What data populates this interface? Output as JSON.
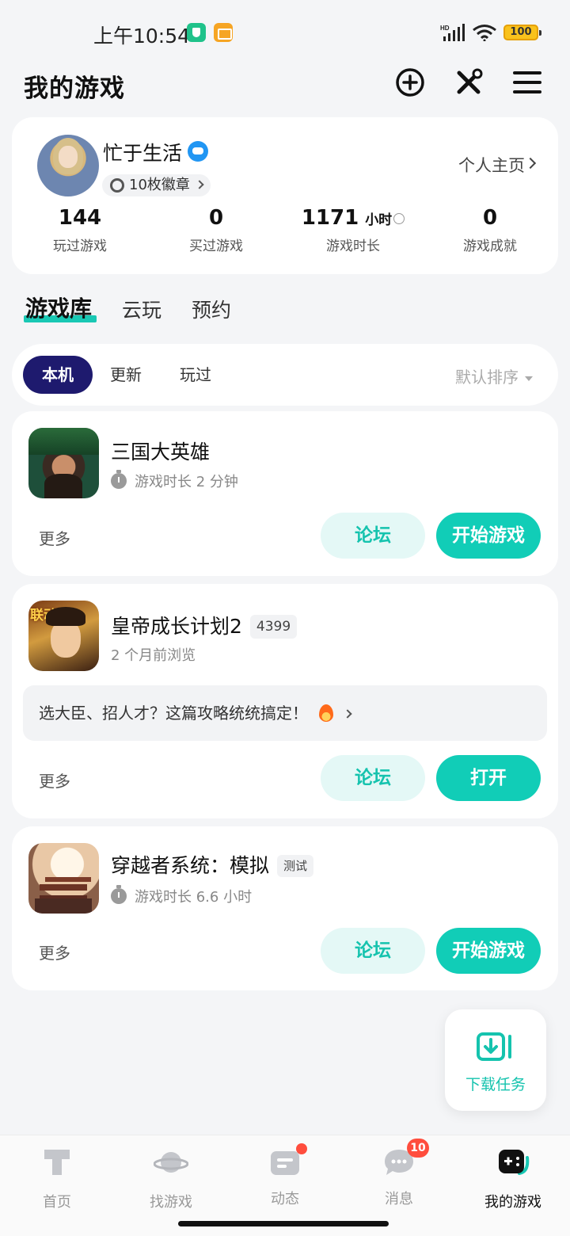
{
  "status_bar": {
    "time": "上午10:54",
    "battery": "100"
  },
  "header": {
    "title": "我的游戏",
    "icons": [
      "add-circle-icon",
      "tools-icon",
      "menu-icon"
    ]
  },
  "profile": {
    "name": "忙于生活",
    "badges": "10枚徽章",
    "home_link": "个人主页",
    "stats": [
      {
        "value": "144",
        "unit": "",
        "label": "玩过游戏"
      },
      {
        "value": "0",
        "unit": "",
        "label": "买过游戏"
      },
      {
        "value": "1171",
        "unit": "小时",
        "label": "游戏时长"
      },
      {
        "value": "0",
        "unit": "",
        "label": "游戏成就"
      }
    ]
  },
  "main_tabs": [
    "游戏库",
    "云玩",
    "预约"
  ],
  "filters": {
    "chips": [
      "本机",
      "更新",
      "玩过"
    ],
    "sort": "默认排序"
  },
  "games": [
    {
      "title": "三国大英雄",
      "tag": "",
      "meta": "游戏时长 2 分钟",
      "more": "更多",
      "forum": "论坛",
      "action": "开始游戏"
    },
    {
      "title": "皇帝成长计划2",
      "tag": "4399",
      "icon_text": "联动",
      "meta": "2 个月前浏览",
      "guide": "选大臣、招人才？这篇攻略统统搞定！",
      "more": "更多",
      "forum": "论坛",
      "action": "打开"
    },
    {
      "title": "穿越者系统：模拟",
      "tag": "测试",
      "meta": "游戏时长 6.6 小时",
      "more": "更多",
      "forum": "论坛",
      "action": "开始游戏"
    }
  ],
  "download_task": "下载任务",
  "bottom_nav": [
    {
      "label": "首页",
      "badge": ""
    },
    {
      "label": "找游戏",
      "badge": ""
    },
    {
      "label": "动态",
      "badge": "dot"
    },
    {
      "label": "消息",
      "badge": "10"
    },
    {
      "label": "我的游戏",
      "badge": ""
    }
  ],
  "colors": {
    "accent": "#11cdb7",
    "chip_active": "#1e1a6e",
    "badge": "#ff4d3d"
  }
}
